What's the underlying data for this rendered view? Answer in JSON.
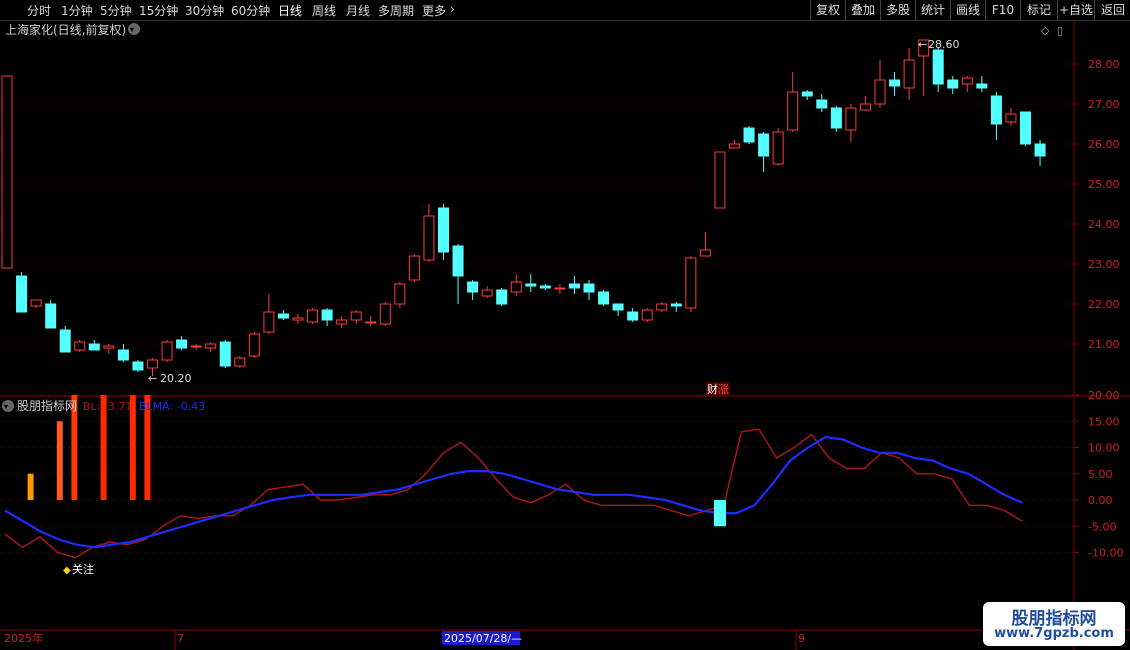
{
  "toolbar": {
    "periods": [
      "分时",
      "1分钟",
      "5分钟",
      "15分钟",
      "30分钟",
      "60分钟",
      "日线",
      "周线",
      "月线",
      "多周期",
      "更多"
    ],
    "active_period": "日线",
    "right_buttons": [
      "复权",
      "叠加",
      "多股",
      "统计",
      "画线",
      "F10",
      "+自选",
      "返回"
    ],
    "mark_label": "标记"
  },
  "main_panel": {
    "title": "上海家化(日线,前复权)",
    "max_label": "28.60",
    "min_label": "20.20",
    "event_badge": "财",
    "event_badge2": "涨",
    "y_ticks": [
      "28.00",
      "27.00",
      "26.00",
      "25.00",
      "24.00",
      "23.00",
      "22.00",
      "21.00"
    ],
    "y_values": [
      28,
      27,
      26,
      25,
      24,
      23,
      22,
      21
    ]
  },
  "indicator_panel": {
    "title": "股朋指标网",
    "bl_label": "BL: -3.71",
    "blma_label": "BLMA: -0.43",
    "note_label": "关注",
    "y_ticks": [
      "20.00",
      "15.00",
      "10.00",
      "5.00",
      "0.00",
      "-5.00",
      "-10.00"
    ],
    "y_values": [
      20,
      15,
      10,
      5,
      0,
      -5,
      -10
    ]
  },
  "date_axis": {
    "start_label": "2025年",
    "mid_labels": [
      "7",
      "9"
    ],
    "cursor_label": "2025/07/28/—"
  },
  "watermark": {
    "line1": "股朋指标网",
    "line2": "www.7gpzb.com"
  },
  "colors": {
    "up": "#ff3b3b",
    "down": "#54ffff",
    "bl": "#b01818",
    "blma": "#1e2cff",
    "grid": "#5a0000",
    "axis": "#8b0000",
    "bar_orange": "#ff9a00",
    "bar_red": "#ff2a00"
  },
  "chart_data": {
    "type": "candlestick",
    "candles": [
      [
        22.9,
        27.7,
        22.9,
        27.7
      ],
      [
        22.7,
        21.8,
        22.8,
        21.8
      ],
      [
        21.95,
        22.1,
        21.9,
        22.05
      ],
      [
        22.0,
        21.4,
        22.1,
        21.4
      ],
      [
        21.35,
        20.8,
        21.45,
        20.8
      ],
      [
        20.85,
        21.05,
        20.8,
        21.1
      ],
      [
        21.0,
        20.85,
        20.95,
        21.1
      ],
      [
        20.9,
        20.95,
        20.75,
        21.0
      ],
      [
        20.85,
        20.6,
        20.55,
        21.0
      ],
      [
        20.55,
        20.35,
        20.3,
        20.6
      ],
      [
        20.4,
        20.6,
        20.2,
        20.65
      ],
      [
        20.6,
        21.05,
        20.55,
        21.1
      ],
      [
        21.1,
        20.9,
        20.85,
        21.2
      ],
      [
        20.95,
        20.95,
        20.85,
        21.0
      ],
      [
        20.9,
        21.0,
        20.8,
        21.05
      ],
      [
        21.05,
        20.45,
        20.4,
        21.1
      ],
      [
        20.45,
        20.65,
        20.4,
        20.7
      ],
      [
        20.7,
        21.25,
        20.65,
        21.3
      ],
      [
        21.3,
        21.8,
        21.25,
        22.25
      ],
      [
        21.75,
        21.65,
        21.6,
        21.85
      ],
      [
        21.6,
        21.65,
        21.5,
        21.75
      ],
      [
        21.55,
        21.85,
        21.5,
        21.9
      ],
      [
        21.85,
        21.6,
        21.45,
        21.9
      ],
      [
        21.5,
        21.6,
        21.4,
        21.7
      ],
      [
        21.6,
        21.8,
        21.5,
        21.85
      ],
      [
        21.55,
        21.55,
        21.45,
        21.7
      ],
      [
        21.5,
        22.0,
        21.45,
        22.05
      ],
      [
        22.0,
        22.5,
        21.9,
        22.55
      ],
      [
        22.6,
        23.2,
        22.55,
        23.25
      ],
      [
        23.1,
        24.2,
        23.05,
        24.5
      ],
      [
        24.4,
        23.3,
        23.1,
        24.5
      ],
      [
        23.45,
        22.7,
        22.0,
        23.5
      ],
      [
        22.55,
        22.3,
        22.1,
        22.6
      ],
      [
        22.2,
        22.35,
        22.15,
        22.45
      ],
      [
        22.35,
        22.0,
        21.95,
        22.4
      ],
      [
        22.3,
        22.55,
        22.2,
        22.75
      ],
      [
        22.5,
        22.45,
        22.3,
        22.75
      ],
      [
        22.45,
        22.4,
        22.35,
        22.5
      ],
      [
        22.4,
        22.4,
        22.25,
        22.5
      ],
      [
        22.5,
        22.4,
        22.25,
        22.7
      ],
      [
        22.5,
        22.3,
        22.1,
        22.6
      ],
      [
        22.3,
        22.0,
        21.95,
        22.35
      ],
      [
        22.0,
        21.85,
        21.7,
        22.0
      ],
      [
        21.8,
        21.6,
        21.55,
        21.9
      ],
      [
        21.6,
        21.85,
        21.55,
        21.9
      ],
      [
        21.85,
        22.0,
        21.8,
        22.05
      ],
      [
        22.0,
        21.95,
        21.8,
        22.05
      ],
      [
        21.9,
        23.15,
        21.8,
        23.2
      ],
      [
        23.2,
        23.35,
        23.3,
        23.8
      ],
      [
        24.4,
        25.8,
        24.4,
        25.8
      ],
      [
        25.9,
        26.0,
        25.95,
        26.1
      ],
      [
        26.4,
        26.05,
        26.0,
        26.45
      ],
      [
        26.25,
        25.7,
        25.3,
        26.3
      ],
      [
        25.5,
        26.3,
        25.45,
        26.4
      ],
      [
        26.35,
        27.3,
        26.3,
        27.8
      ],
      [
        27.3,
        27.2,
        27.1,
        27.35
      ],
      [
        27.1,
        26.9,
        26.8,
        27.25
      ],
      [
        26.9,
        26.4,
        26.3,
        26.95
      ],
      [
        26.35,
        26.9,
        26.05,
        27.0
      ],
      [
        26.85,
        27.0,
        26.85,
        27.2
      ],
      [
        27.0,
        27.6,
        26.9,
        28.1
      ],
      [
        27.6,
        27.45,
        27.2,
        27.8
      ],
      [
        27.4,
        28.1,
        27.1,
        28.4
      ],
      [
        28.2,
        28.6,
        27.2,
        28.6
      ],
      [
        28.35,
        27.5,
        27.3,
        28.4
      ],
      [
        27.6,
        27.4,
        27.25,
        27.7
      ],
      [
        27.5,
        27.65,
        27.3,
        27.7
      ],
      [
        27.5,
        27.4,
        27.3,
        27.7
      ],
      [
        27.2,
        26.5,
        26.1,
        27.3
      ],
      [
        26.55,
        26.75,
        26.45,
        26.9
      ],
      [
        26.8,
        26.0,
        25.95,
        26.8
      ],
      [
        26.0,
        25.7,
        25.45,
        26.1
      ]
    ],
    "bl": [
      -6.5,
      -9,
      -7,
      -10,
      -11,
      -9,
      -8,
      -8.5,
      -7.5,
      -5,
      -3,
      -3.5,
      -3,
      -3,
      -1,
      2,
      2.5,
      3,
      0,
      0,
      0.5,
      1,
      1,
      2,
      5,
      9,
      11,
      8,
      4,
      0.5,
      -0.5,
      1,
      3,
      0,
      -1,
      -1,
      -1,
      -1,
      -2,
      -3,
      -2,
      -1,
      13,
      13.5,
      8,
      10,
      12.5,
      8,
      6,
      6,
      9,
      8,
      5,
      5,
      4,
      -1,
      -1,
      -2,
      -4
    ],
    "blma": [
      -2,
      -4,
      -6,
      -7.5,
      -8.5,
      -9,
      -8.5,
      -8,
      -7,
      -6,
      -5,
      -4,
      -3,
      -2,
      -1,
      0,
      0.5,
      1,
      1,
      1,
      1,
      1.5,
      2,
      3,
      4,
      5,
      5.5,
      5.5,
      5,
      4,
      3,
      2,
      1.5,
      1,
      1,
      1,
      0.5,
      0,
      -1,
      -2,
      -2.5,
      -2.5,
      -1,
      3,
      7.5,
      10,
      12,
      11.5,
      10,
      9,
      9,
      8,
      7.5,
      6,
      5,
      3,
      1,
      -0.5
    ],
    "bl_bars": [
      [
        1,
        5,
        "#ff9a00"
      ],
      [
        3,
        15,
        "#ff5a1a"
      ],
      [
        4,
        20,
        "#ff3a00"
      ],
      [
        6,
        20,
        "#ff2a00"
      ],
      [
        8,
        20,
        "#ff2a00"
      ],
      [
        9,
        20,
        "#ff2a00"
      ]
    ],
    "cyan_bar": {
      "index": 49,
      "value": -5
    }
  }
}
